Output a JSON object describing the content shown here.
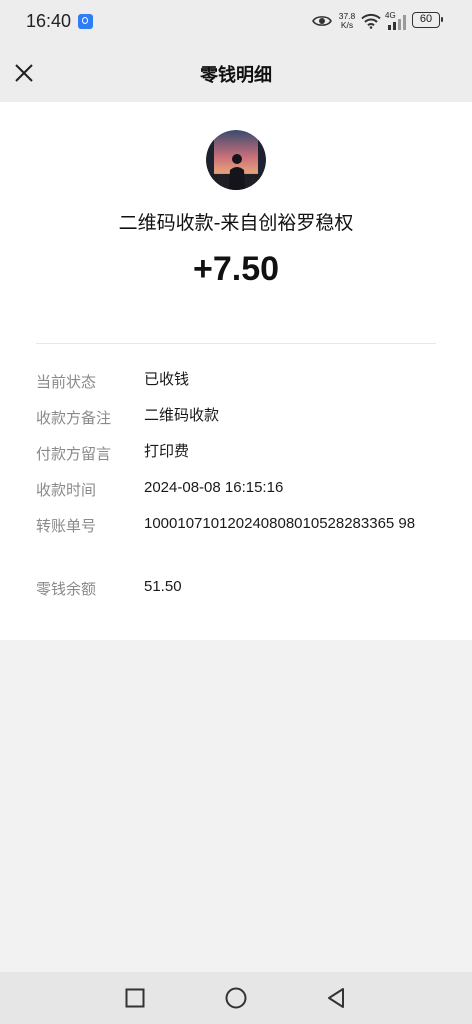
{
  "status_bar": {
    "time": "16:40",
    "net_speed_value": "37.8",
    "net_speed_unit": "K/s",
    "network_type": "4G",
    "battery": "60"
  },
  "header": {
    "title": "零钱明细"
  },
  "transaction": {
    "title": "二维码收款-来自创裕罗稳权",
    "amount": "+7.50",
    "details": [
      {
        "label": "当前状态",
        "value": "已收钱"
      },
      {
        "label": "收款方备注",
        "value": "二维码收款"
      },
      {
        "label": "付款方留言",
        "value": "打印费"
      },
      {
        "label": "收款时间",
        "value": "2024-08-08 16:15:16"
      },
      {
        "label": "转账单号",
        "value": "100010710120240808010528283365 98"
      },
      {
        "label": "零钱余额",
        "value": "51.50"
      }
    ]
  },
  "icons": {
    "close": "close-icon",
    "home": "circle-home-icon",
    "recent": "square-recents-icon",
    "back": "triangle-back-icon"
  }
}
